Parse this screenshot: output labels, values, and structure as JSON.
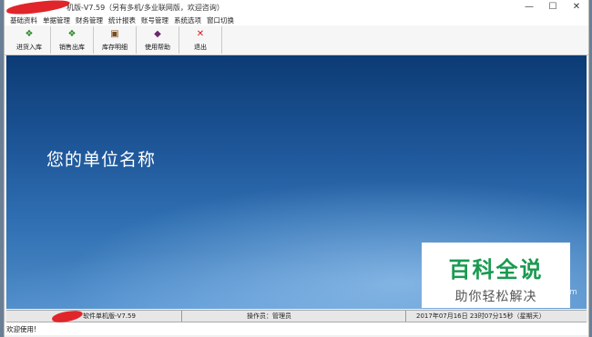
{
  "window": {
    "title": "机版-V7.59（另有多机/多业联网版，欢迎咨询）",
    "controls": {
      "minimize": "—",
      "maximize": "☐",
      "close": "✕"
    }
  },
  "menubar": {
    "items": [
      "基础资料",
      "单据管理",
      "财务管理",
      "统计报表",
      "账号管理",
      "系统选项",
      "窗口切换"
    ]
  },
  "toolbar": {
    "buttons": [
      {
        "label": "进货入库",
        "icon": "stock-in-icon"
      },
      {
        "label": "销售出库",
        "icon": "stock-out-icon"
      },
      {
        "label": "库存明细",
        "icon": "inventory-icon"
      },
      {
        "label": "使用帮助",
        "icon": "help-book-icon"
      },
      {
        "label": "退出",
        "icon": "close-icon"
      }
    ]
  },
  "workspace": {
    "company_name": "您的单位名称"
  },
  "watermark": {
    "title": "百科全说",
    "subtitle": "助你轻松解决",
    "edge_text": "m"
  },
  "statusbar": {
    "app_name": "软件单机版-V7.59",
    "operator": "操作员：管理员",
    "datetime": "2017年07月16日 23时07分15秒（星期天）",
    "welcome": "欢迎使用!"
  },
  "colors": {
    "workspace_top": "#0c3b74",
    "workspace_bottom": "#4f8cc8",
    "watermark_green": "#1a9a50",
    "redaction_red": "#e0262b"
  }
}
